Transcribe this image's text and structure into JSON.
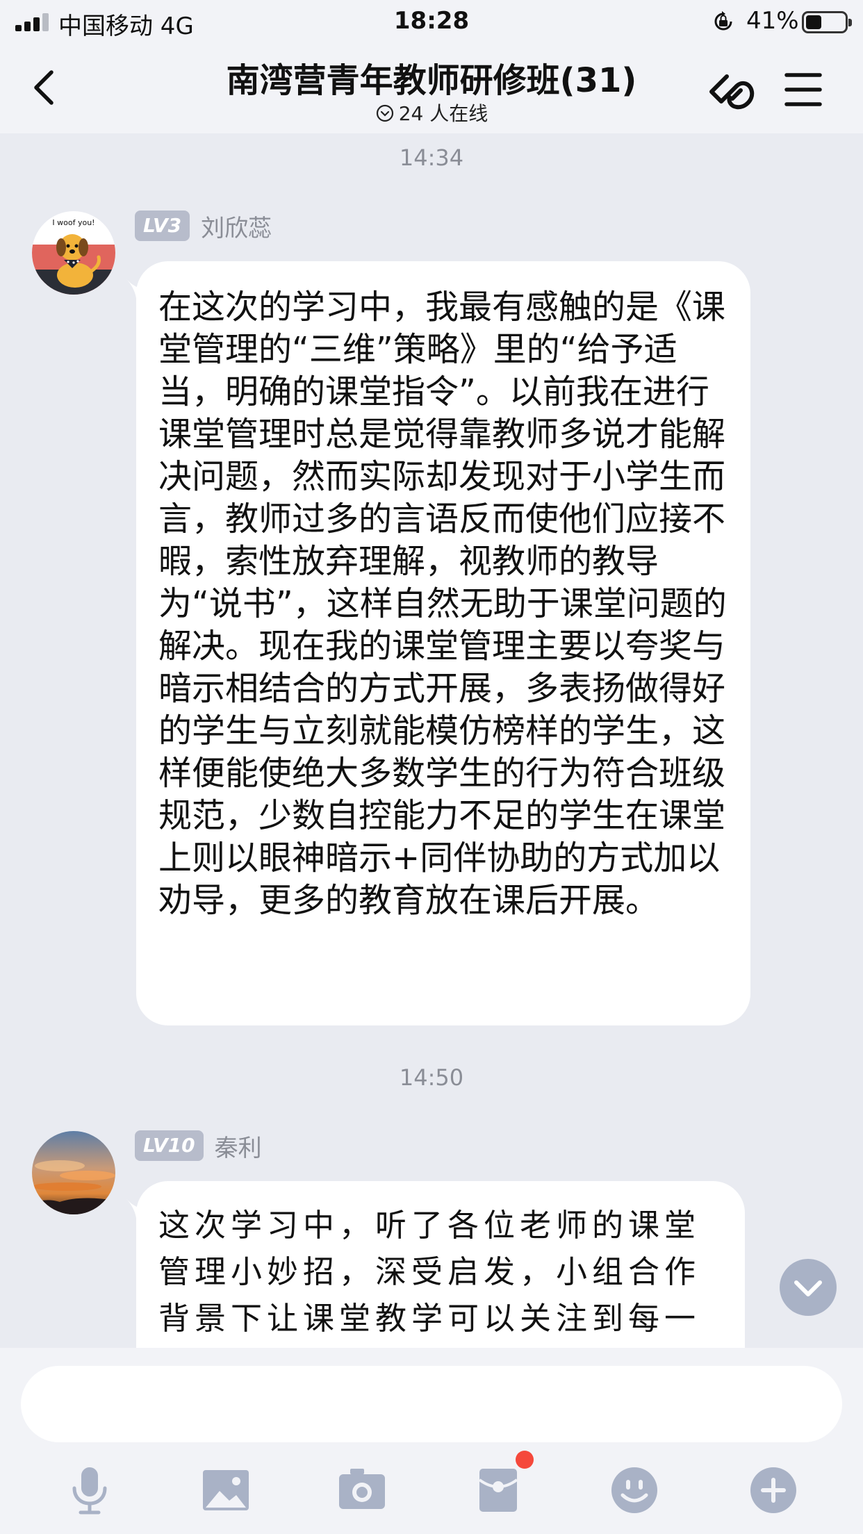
{
  "status_bar": {
    "carrier": "中国移动  4G",
    "time": "18:28",
    "battery": "41%",
    "battery_level": 0.41
  },
  "header": {
    "title": "南湾营青年教师研修班(31)",
    "online": "24 人在线"
  },
  "messages": [
    {
      "timestamp": "14:34",
      "level": "LV3",
      "sender": "刘欣蕊",
      "avatar_icon": "dog-cartoon-avatar",
      "avatar_caption": "I woof you!",
      "text": "在这次的学习中，我最有感触的是《课堂管理的“三维”策略》里的“给予适当，明确的课堂指令”。以前我在进行课堂管理时总是觉得靠教师多说才能解决问题，然而实际却发现对于小学生而言，教师过多的言语反而使他们应接不暇，索性放弃理解，视教师的教导为“说书”，这样自然无助于课堂问题的解决。现在我的课堂管理主要以夸奖与暗示相结合的方式开展，多表扬做得好的学生与立刻就能模仿榜样的学生，这样便能使绝大多数学生的行为符合班级规范，少数自控能力不足的学生在课堂上则以眼神暗示+同伴协助的方式加以劝导，更多的教育放在课后开展。"
    },
    {
      "timestamp": "14:50",
      "level": "LV10",
      "sender": "秦利",
      "avatar_icon": "sunset-sky-avatar",
      "text": "这次学习中，听了各位老师的课堂管理小妙招，深受启发，小组合作背景下让课堂教学可以关注到每一个孩子，同时，孩子们表达的欲望也更强"
    }
  ],
  "input": {
    "placeholder": ""
  },
  "toolbar": {
    "icons": [
      "microphone-icon",
      "image-icon",
      "camera-icon",
      "red-packet-icon",
      "emoji-icon",
      "plus-icon"
    ],
    "notification_dot_color": "#f5483b"
  },
  "colors": {
    "background": "#e9ebf1",
    "bar": "#f2f3f7",
    "bubble": "#ffffff",
    "level_badge": "#b7bccb",
    "secondary_text": "#8a8d96",
    "icon_gray": "#a9b2c6"
  }
}
